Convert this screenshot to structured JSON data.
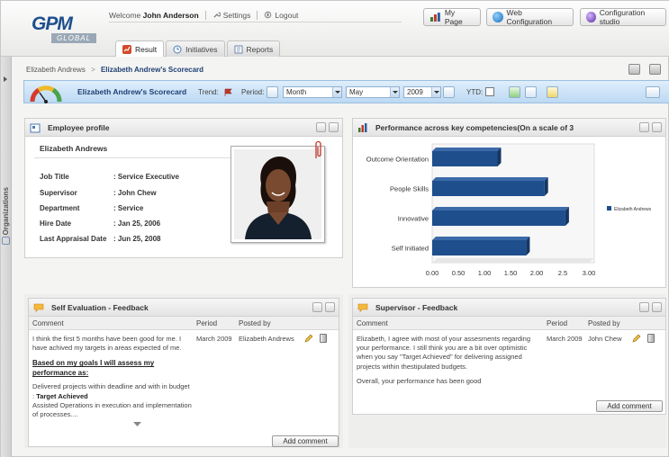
{
  "header": {
    "logo_text": "GPM",
    "logo_sub": "GLOBAL",
    "welcome_prefix": "Welcome",
    "user_name": "John Anderson",
    "settings_label": "Settings",
    "logout_label": "Logout",
    "my_page_label": "My Page",
    "web_config_label": "Web Configuration",
    "config_studio_label": "Configuration studio"
  },
  "tabs": [
    {
      "label": "Result",
      "active": true
    },
    {
      "label": "Initiatives",
      "active": false
    },
    {
      "label": "Reports",
      "active": false
    }
  ],
  "rail": {
    "label": "Organizations"
  },
  "breadcrumb": {
    "parent": "Elizabeth Andrews",
    "separator": ">",
    "current": "Elizabeth Andrew's Scorecard"
  },
  "toolbar": {
    "title": "Elizabeth Andrew's Scorecard",
    "trend_label": "Trend:",
    "period_label": "Period:",
    "period_value": "Month",
    "month_value": "May",
    "year_value": "2009",
    "ytd_label": "YTD:"
  },
  "profile": {
    "panel_title": "Employee profile",
    "name": "Elizabeth Andrews",
    "fields": [
      {
        "label": "Job Title",
        "value": ": Service Executive"
      },
      {
        "label": "Supervisor",
        "value": ": John Chew"
      },
      {
        "label": "Department",
        "value": ": Service"
      },
      {
        "label": "Hire Date",
        "value": ": Jan 25, 2006"
      },
      {
        "label": "Last Appraisal Date",
        "value": ": Jun 25, 2008"
      }
    ]
  },
  "performance": {
    "panel_title": "Performance across key competencies(On a scale of 3"
  },
  "chart_data": {
    "type": "bar",
    "orientation": "horizontal",
    "title": "Performance across key competencies(On a scale of 3",
    "categories": [
      "Outcome Orientation",
      "People Skills",
      "Innovative",
      "Self Initiated"
    ],
    "series": [
      {
        "name": "Elizabeth Andrews",
        "values": [
          1.25,
          2.15,
          2.55,
          1.8
        ],
        "color": "#1f4e8c"
      }
    ],
    "xlim": [
      0,
      3
    ],
    "xticks": [
      "0.00",
      "0.50",
      "1.00",
      "1.50",
      "2.00",
      "2.5",
      "3.00"
    ],
    "legend_position": "right",
    "grid": false
  },
  "self_feedback": {
    "panel_title": "Self Evaluation - Feedback",
    "col_comment": "Comment",
    "col_period": "Period",
    "col_posted": "Posted by",
    "para1": "I think the first 5 months have been good for me. I have achived my targets in areas expected of me.",
    "heading": "Based on my goals I will assess my performance as:",
    "line1_prefix": "Delivered projects within deadline and with in budget :",
    "line1_status": "Target Achieved",
    "line2": "Assisted Operations in execution and implementation of processes....",
    "period": "March 2009",
    "posted_by": "Elizabeth Andrews",
    "add_label": "Add comment"
  },
  "supervisor_feedback": {
    "panel_title": "Supervisor - Feedback",
    "col_comment": "Comment",
    "col_period": "Period",
    "col_posted": "Posted by",
    "para1": "Elizabeth, I agree with most of your assesments regarding your performance. I still think you are a bit over optimistic when you say \"Target Achieved\" for delivering assigned projects within thestipulated budgets.",
    "para2": "Overall, your performance has been good",
    "period": "March 2009",
    "posted_by": "John Chew",
    "add_label": "Add comment"
  }
}
